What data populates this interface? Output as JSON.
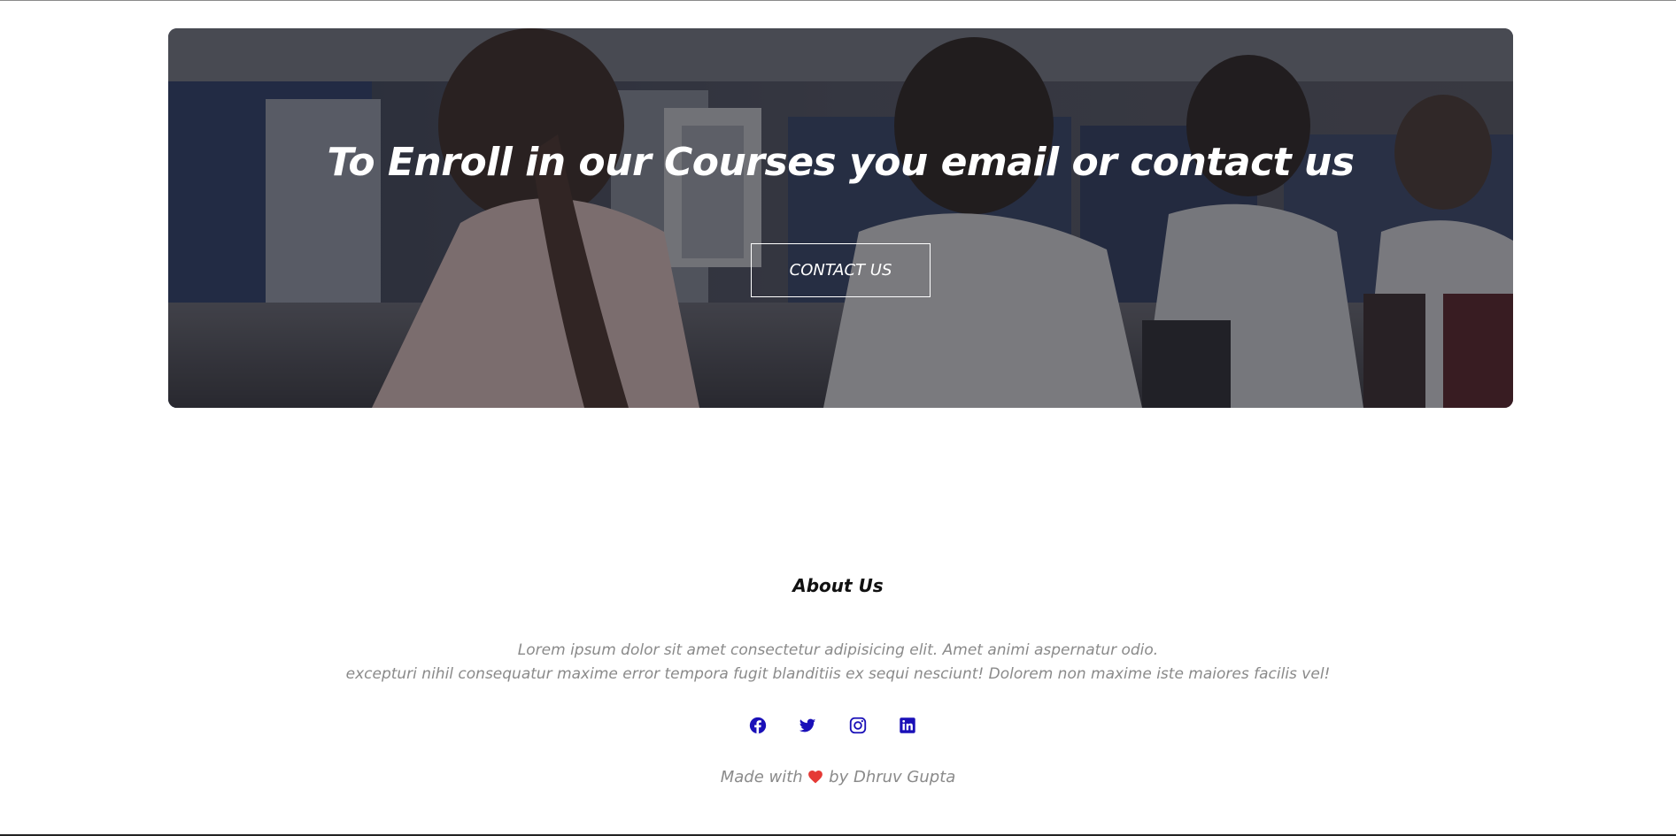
{
  "hero": {
    "title": "To Enroll in our Courses you email or contact us",
    "button_label": "CONTACT US"
  },
  "about": {
    "title": "About Us",
    "lines": [
      "Lorem ipsum dolor sit amet consectetur adipisicing elit. Amet animi aspernatur odio.",
      "excepturi nihil consequatur maxime error tempora fugit blanditiis ex sequi nesciunt! Dolorem non maxime iste maiores facilis vel!"
    ]
  },
  "social": {
    "icons": [
      "facebook-icon",
      "twitter-icon",
      "instagram-icon",
      "linkedin-icon"
    ],
    "color": "#1a10b8"
  },
  "credit": {
    "prefix": "Made with",
    "suffix": "by Dhruv Gupta",
    "heart_color": "#e53935"
  },
  "colors": {
    "hero_overlay": "#19181e",
    "text_muted": "#8a8a8a"
  }
}
